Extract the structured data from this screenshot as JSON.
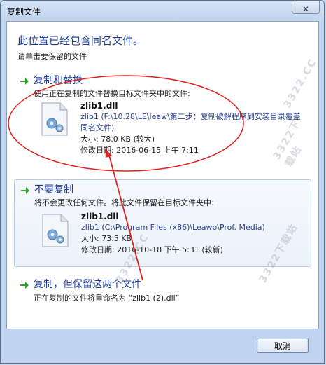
{
  "window": {
    "title": "复制文件",
    "close_symbol": "✕"
  },
  "main": {
    "heading": "此位置已经包含同名文件。",
    "subheading": "请单击要保留的文件"
  },
  "options": [
    {
      "title": "复制和替换",
      "description": "使用正在复制的文件替换目标文件夹中的文件:",
      "file": {
        "name": "zlib1.dll",
        "path": "zlib1 (F:\\10.28\\LE\\leaw\\第二步：复制破解程序到安装目录覆盖同名文件)",
        "size": "大小: 78.0 KB (较大)",
        "modified": "修改日期: 2016-06-15 上午 7:11"
      }
    },
    {
      "title": "不要复制",
      "description": "将不会更改任何文件。将此文件保留在目标文件夹中:",
      "file": {
        "name": "zlib1.dll",
        "path": "zlib1 (C:\\Program Files (x86)\\Leawo\\Prof. Media)",
        "size": "大小: 73.5 KB",
        "modified": "修改日期: 2016-10-18 下午 5:31 (较新)"
      }
    },
    {
      "title": "复制，但保留这两个文件",
      "description": "正在复制的文件将重命名为 “zlib1 (2).dll”"
    }
  ],
  "footer": {
    "cancel_label": "取消"
  },
  "watermarks": [
    "3322.CC",
    "3322下载站",
    "3322.CC",
    "3322下载站"
  ],
  "colors": {
    "accent": "#1e3b9a",
    "annotation_red": "#e0201c",
    "arrow_green": "#2aa52a"
  }
}
